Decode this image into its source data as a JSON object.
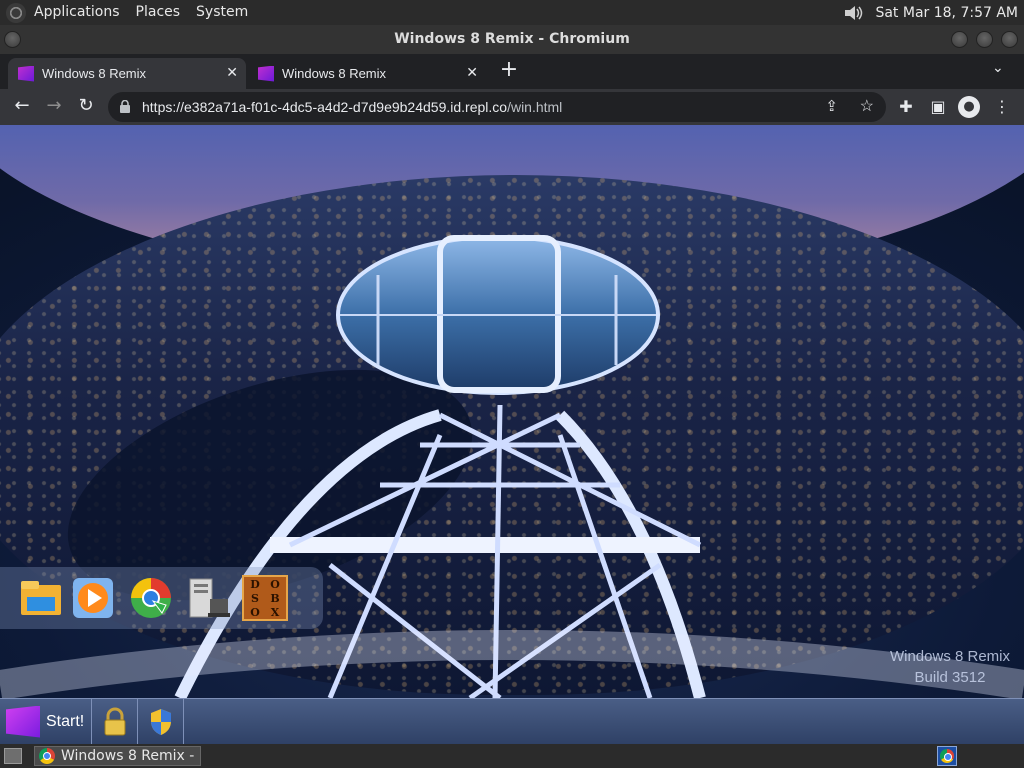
{
  "top_panel": {
    "menus": [
      "Applications",
      "Places",
      "System"
    ],
    "clock": "Sat Mar 18,  7:57 AM",
    "icons": {
      "logo": "distro-logo-icon",
      "volume": "speaker-icon"
    }
  },
  "window": {
    "title": "Windows 8 Remix - Chromium"
  },
  "tabs": [
    {
      "title": "Windows 8 Remix",
      "active": true
    },
    {
      "title": "Windows 8 Remix",
      "active": false
    }
  ],
  "toolbar": {
    "url_host": "https://e382a71a-f01c-4dc5-a4d2-d7d9e9b24d59.id.repl.co",
    "url_path": "/win.html"
  },
  "desktop": {
    "launcher_icons": [
      "file-explorer-icon",
      "media-player-icon",
      "browser-globe-icon",
      "computer-icon",
      "dosbox-icon"
    ],
    "dosbox_letters": [
      "D",
      "O",
      "S",
      "B",
      "O",
      "X"
    ],
    "watermark": {
      "line1": "Windows 8 Remix",
      "line2": "Build 3512"
    }
  },
  "taskbar": {
    "start_label": "Start!",
    "buttons": [
      "lock-icon",
      "security-shield-icon"
    ]
  },
  "bottom_panel": {
    "task_label": "Windows 8 Remix - ..."
  },
  "colors": {
    "panel": "#2b2b2b",
    "tab_active": "#35363a",
    "taskbar": "#3b4e75",
    "accent_purple": "#a030e0"
  }
}
